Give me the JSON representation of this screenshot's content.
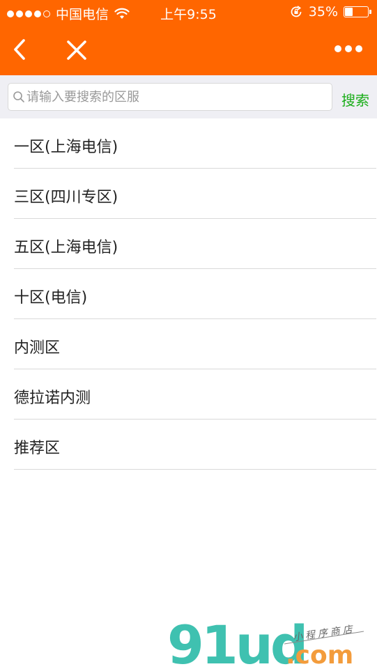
{
  "status_bar": {
    "carrier": "中国电信",
    "time": "上午9:55",
    "battery_percent": "35%",
    "battery_level": 0.35
  },
  "nav": {
    "back_icon": "chevron-left-icon",
    "close_icon": "close-icon",
    "more_icon": "more-dots-icon"
  },
  "search": {
    "placeholder": "请输入要搜索的区服",
    "value": "",
    "button_label": "搜索"
  },
  "servers": [
    {
      "label": "一区(上海电信)"
    },
    {
      "label": "三区(四川专区)"
    },
    {
      "label": "五区(上海电信)"
    },
    {
      "label": "十区(电信)"
    },
    {
      "label": "内测区"
    },
    {
      "label": "德拉诺内测"
    },
    {
      "label": "推荐区"
    }
  ],
  "watermark": {
    "brand": "91ud",
    "domain": ".com",
    "tagline": "小程序商店"
  },
  "colors": {
    "header": "#ff6600",
    "search_button": "#1aad19",
    "watermark_teal": "#3fc1b0",
    "watermark_orange": "#f39c3c"
  }
}
